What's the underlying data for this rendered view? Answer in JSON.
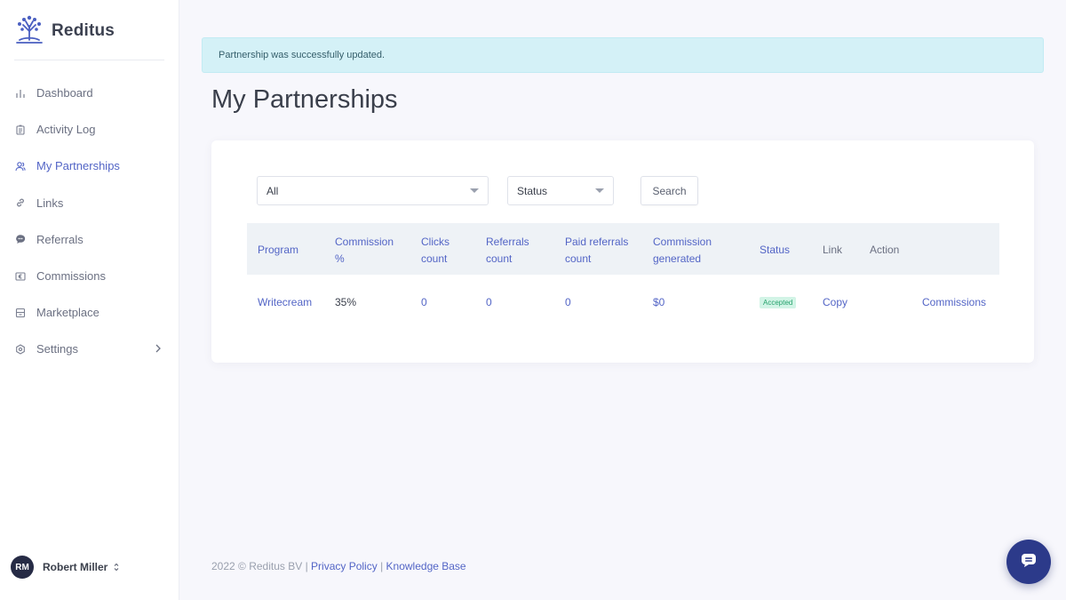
{
  "brand": {
    "name": "Reditus",
    "icon": "tree-logo-icon"
  },
  "sidebar": {
    "items": [
      {
        "label": "Dashboard",
        "icon": "bar-chart-icon",
        "active": false
      },
      {
        "label": "Activity Log",
        "icon": "clipboard-icon",
        "active": false
      },
      {
        "label": "My Partnerships",
        "icon": "users-icon",
        "active": true
      },
      {
        "label": "Links",
        "icon": "link-icon",
        "active": false
      },
      {
        "label": "Referrals",
        "icon": "chat-bubble-icon",
        "active": false
      },
      {
        "label": "Commissions",
        "icon": "euro-icon",
        "active": false
      },
      {
        "label": "Marketplace",
        "icon": "store-icon",
        "active": false
      },
      {
        "label": "Settings",
        "icon": "gear-icon",
        "active": false
      }
    ]
  },
  "user": {
    "initials": "RM",
    "name": "Robert Miller"
  },
  "alert": {
    "message": "Partnership was successfully updated."
  },
  "page": {
    "title": "My Partnerships"
  },
  "filters": {
    "program": "All",
    "status": "Status",
    "search_label": "Search"
  },
  "table": {
    "headers": {
      "program": "Program",
      "commission_line1": "Commission",
      "commission_line2": "%",
      "clicks_line1": "Clicks",
      "clicks_line2": "count",
      "referrals_line1": "Referrals",
      "referrals_line2": "count",
      "paid_line1": "Paid referrals",
      "paid_line2": "count",
      "generated_line1": "Commission",
      "generated_line2": "generated",
      "status": "Status",
      "link": "Link",
      "action": "Action"
    },
    "rows": [
      {
        "program": "Writecream",
        "commission": "35%",
        "clicks": "0",
        "referrals": "0",
        "paid_referrals": "0",
        "generated": "$0",
        "status": "Accepted",
        "link": "Copy",
        "action": "Commissions"
      }
    ]
  },
  "footer": {
    "copyright": "2022 © Reditus BV |",
    "privacy": "Privacy Policy",
    "separator": "|",
    "knowledge": "Knowledge Base"
  },
  "colors": {
    "accent": "#5365c6",
    "alert_bg": "#d4f1f7",
    "badge_bg": "#d2f4e6",
    "chat_bg": "#2c3a8a"
  }
}
